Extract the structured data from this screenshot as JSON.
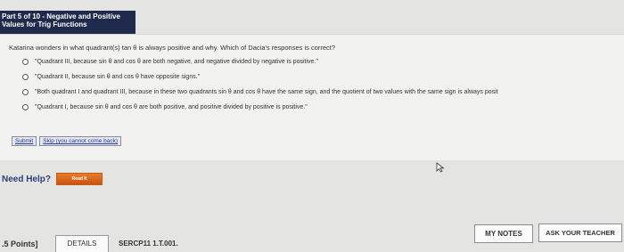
{
  "header": {
    "line1": "Part 5 of 10 - Negative and Positive",
    "line2": "Values for Trig Functions"
  },
  "question": {
    "text": "Katarina wonders in what quadrant(s) tan θ is always positive and why. Which of Dacia's responses is correct?",
    "options": [
      {
        "label": "\"Quadrant III, because sin θ and cos θ are both negative, and negative divided by negative is positive.\""
      },
      {
        "label": "\"Quadrant II, because sin θ and cos θ have opposite signs.\""
      },
      {
        "label": "\"Both quadrant I and quadrant III, because in these two quadrants sin θ and cos θ have the same sign, and the quotient of two values with the same sign is always posit"
      },
      {
        "label": "\"Quadrant I, because sin θ and cos θ are both positive, and positive divided by positive is positive.\""
      }
    ]
  },
  "actions": {
    "submit": "Submit",
    "skip": "Skip (you cannot come back)"
  },
  "help": {
    "label": "Need Help?",
    "read_button": "Read It"
  },
  "footer": {
    "points": ".5 Points]",
    "details": "DETAILS",
    "problem_id": "SERCP11 1.T.001.",
    "my_notes": "MY NOTES",
    "ask_teacher": "ASK YOUR TEACHER"
  },
  "colors": {
    "header_bg": "#1f2a4d",
    "link": "#1e3c9a",
    "help_text": "#2c3f7a",
    "read_button": "#d8661a"
  }
}
